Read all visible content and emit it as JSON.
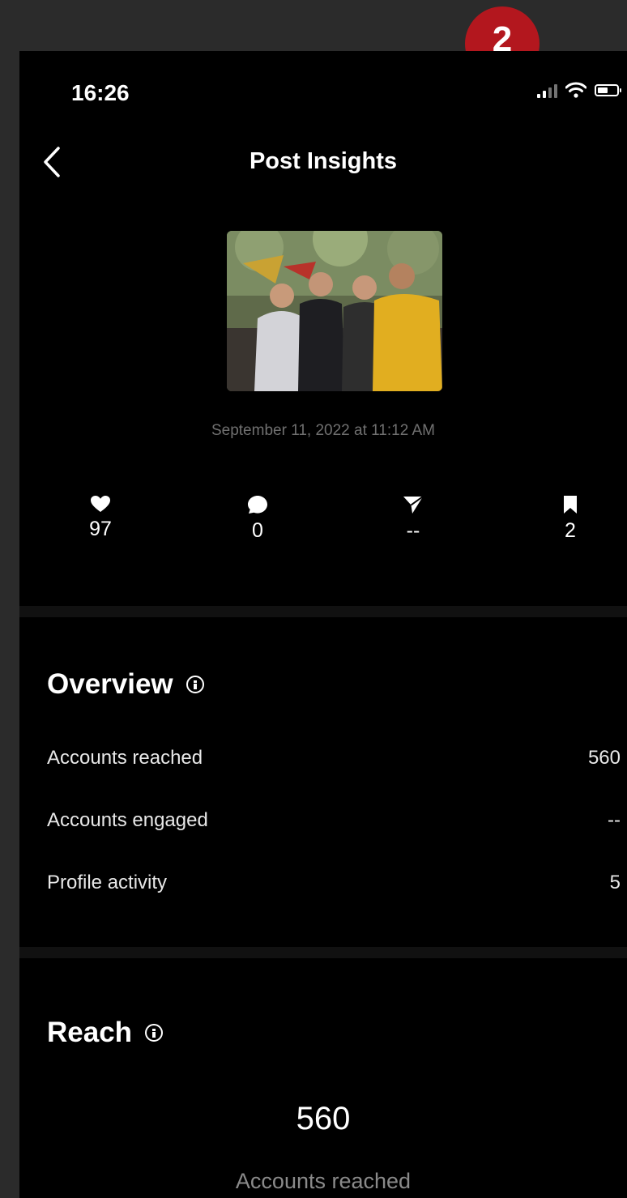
{
  "step_badge": "2",
  "status_bar": {
    "time": "16:26",
    "icons": [
      "signal-icon",
      "wifi-icon",
      "battery-icon"
    ]
  },
  "header": {
    "back_icon": "chevron-left-icon",
    "title": "Post Insights"
  },
  "post": {
    "thumbnail": "photo of four people at an outdoor gathering with flags",
    "date": "September 11, 2022 at 11:12 AM"
  },
  "stats": [
    {
      "icon": "heart-icon",
      "value": "97"
    },
    {
      "icon": "comment-icon",
      "value": "0"
    },
    {
      "icon": "send-icon",
      "value": "--"
    },
    {
      "icon": "bookmark-icon",
      "value": "2"
    }
  ],
  "overview": {
    "title": "Overview",
    "rows": [
      {
        "label": "Accounts reached",
        "value": "560"
      },
      {
        "label": "Accounts engaged",
        "value": "--"
      },
      {
        "label": "Profile activity",
        "value": "5"
      }
    ]
  },
  "reach": {
    "title": "Reach",
    "number": "560",
    "label": "Accounts reached"
  },
  "colors": {
    "badge": "#b3171e",
    "background": "#000000",
    "frame": "#2b2b2b",
    "muted_text": "#707070"
  }
}
